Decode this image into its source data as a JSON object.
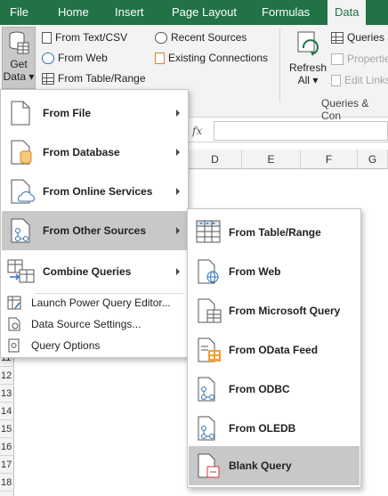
{
  "ribbon_tabs": [
    "File",
    "Home",
    "Insert",
    "Page Layout",
    "Formulas",
    "Data"
  ],
  "active_tab": "Data",
  "get_data": {
    "line1": "Get",
    "line2": "Data"
  },
  "get_transform_items": [
    "From Text/CSV",
    "From Web",
    "From Table/Range"
  ],
  "connection_items": [
    "Recent Sources",
    "Existing Connections"
  ],
  "refresh": {
    "line1": "Refresh",
    "line2": "All"
  },
  "queries_items": [
    "Queries &",
    "Properties",
    "Edit Links"
  ],
  "queries_group_label": "Queries & Con",
  "formula_icon": "fx",
  "columns": [
    "D",
    "E",
    "F",
    "G"
  ],
  "rows": [
    "11",
    "12",
    "13",
    "14",
    "15",
    "16",
    "17",
    "18"
  ],
  "main_menu": [
    {
      "label": "From File",
      "icon": "file-icon",
      "submenu": true
    },
    {
      "label": "From Database",
      "icon": "database-icon",
      "submenu": true
    },
    {
      "label": "From Online Services",
      "icon": "cloud-icon",
      "submenu": true
    },
    {
      "label": "From Other Sources",
      "icon": "other-sources-icon",
      "submenu": true,
      "highlighted": true
    },
    {
      "label": "Combine Queries",
      "icon": "combine-icon",
      "submenu": true
    }
  ],
  "main_menu_small": [
    "Launch Power Query Editor...",
    "Data Source Settings...",
    "Query Options"
  ],
  "sub_menu": [
    {
      "label": "From Table/Range",
      "icon": "table-icon"
    },
    {
      "label": "From Web",
      "icon": "web-icon"
    },
    {
      "label": "From Microsoft Query",
      "icon": "microsoft-query-icon"
    },
    {
      "label": "From OData Feed",
      "icon": "odata-icon"
    },
    {
      "label": "From ODBC",
      "icon": "odbc-icon"
    },
    {
      "label": "From OLEDB",
      "icon": "oledb-icon"
    },
    {
      "label": "Blank Query",
      "icon": "blank-query-icon",
      "highlighted": true
    }
  ],
  "colors": {
    "ribbon_green": "#217346",
    "menu_highlight": "#c8c8c8",
    "icon_blue": "#2f72bb"
  }
}
